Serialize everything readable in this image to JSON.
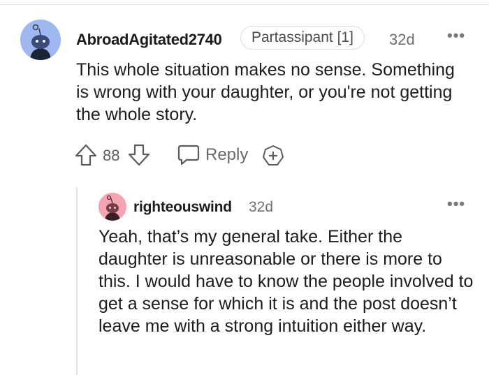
{
  "comment": {
    "username": "AbroadAgitated2740",
    "flair": "Partassipant [1]",
    "time": "32d",
    "more": "•••",
    "body": "This whole situation makes no sense. Something is wrong with your daughter, or you're not getting the whole story.",
    "score": "88",
    "reply_label": "Reply",
    "avatar_color": "#9fb8f0"
  },
  "reply": {
    "username": "righteouswind",
    "time": "32d",
    "more": "•••",
    "body": "Yeah, that’s my general take. Either the daughter is unreasonable or there is more to this. I would have to know the people involved to get a sense for which it is and the post doesn’t leave me with a strong intuition either way.",
    "avatar_color": "#f5a3b0"
  },
  "icons": {
    "upvote": "arrow-up-outline",
    "downvote": "arrow-down-outline",
    "reply": "speech-bubble-outline",
    "award": "plus-circle-outline",
    "more": "horizontal-ellipsis"
  }
}
